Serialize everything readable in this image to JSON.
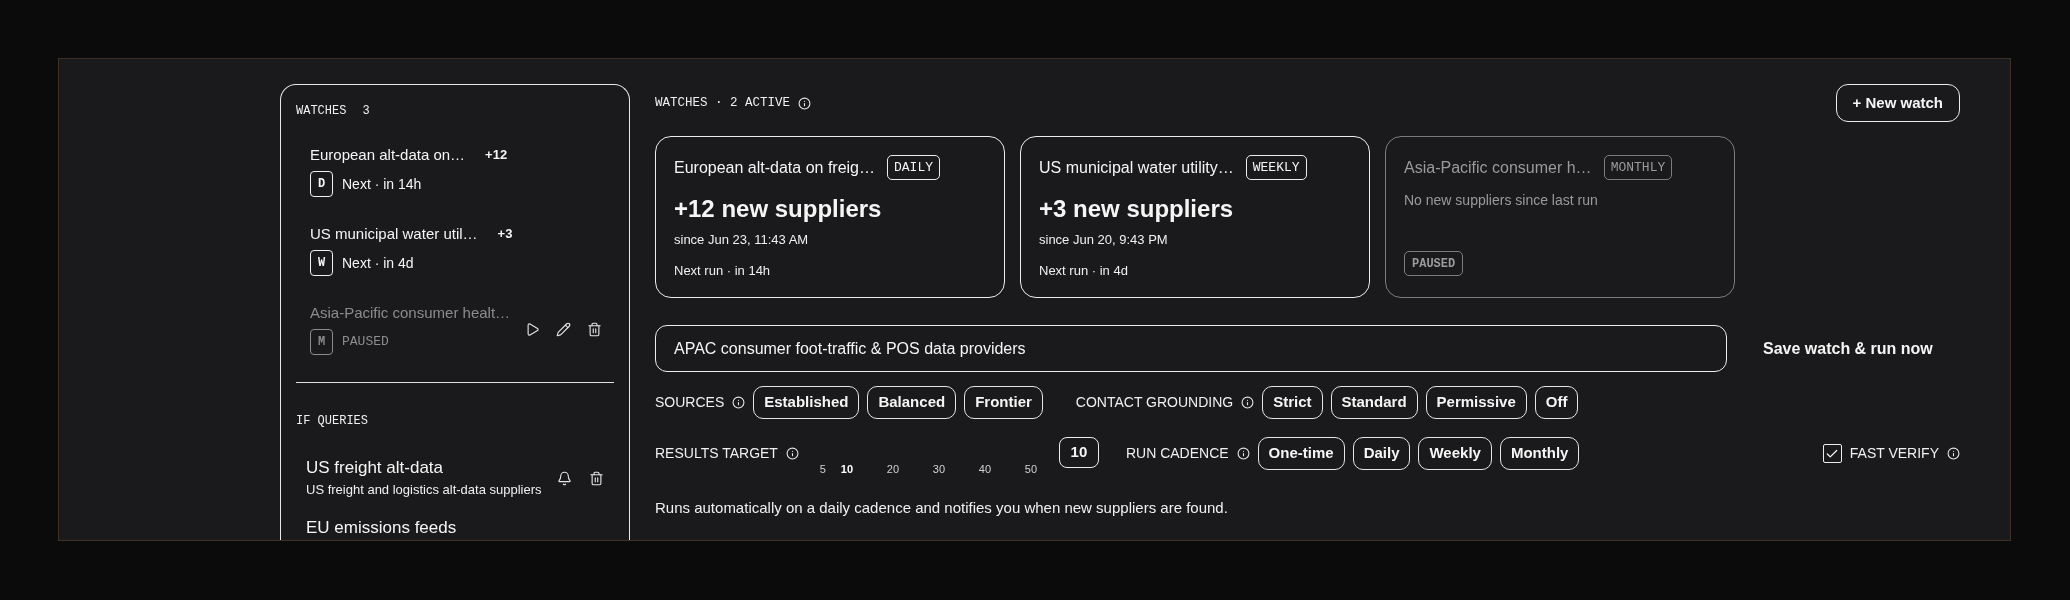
{
  "sidebar": {
    "watches_heading": {
      "label": "WATCHES",
      "count": "3"
    },
    "watches": [
      {
        "title": "European alt-data on…",
        "delta": "+12",
        "cadence": "D",
        "status": "Next · in 14h",
        "paused": false
      },
      {
        "title": "US municipal water util…",
        "delta": "+3",
        "cadence": "W",
        "status": "Next · in 4d",
        "paused": false
      },
      {
        "title": "Asia-Pacific consumer healt…",
        "cadence": "M",
        "status": "PAUSED",
        "paused": true
      }
    ],
    "queries_heading": "IF QUERIES",
    "queries": [
      {
        "title": "US freight alt-data",
        "subtitle": "US freight and logistics alt-data suppliers"
      },
      {
        "title": "EU emissions feeds"
      }
    ]
  },
  "header": {
    "title": "WATCHES · 2 ACTIVE",
    "new_watch_button": "+ New watch"
  },
  "cards": [
    {
      "title": "European alt-data on freig…",
      "cadence": "DAILY",
      "headline": "+12 new suppliers",
      "since": "since Jun 23, 11:43 AM",
      "next_run": "Next run · in 14h",
      "paused": false
    },
    {
      "title": "US municipal water utility…",
      "cadence": "WEEKLY",
      "headline": "+3 new suppliers",
      "since": "since Jun 20, 9:43 PM",
      "next_run": "Next run · in 4d",
      "paused": false
    },
    {
      "title": "Asia-Pacific consumer h…",
      "cadence": "MONTHLY",
      "message": "No new suppliers since last run",
      "status": "PAUSED",
      "paused": true
    }
  ],
  "composer": {
    "query_input": {
      "value": "APAC consumer foot-traffic & POS data providers"
    },
    "save_button": "Save watch & run now",
    "sources": {
      "label": "SOURCES",
      "options": [
        "Established",
        "Balanced",
        "Frontier"
      ]
    },
    "contact_grounding": {
      "label": "CONTACT GROUNDING",
      "options": [
        "Strict",
        "Standard",
        "Permissive",
        "Off"
      ]
    },
    "results_target": {
      "label": "RESULTS TARGET",
      "ticks": [
        {
          "label": "5",
          "selected": false
        },
        {
          "label": "10",
          "selected": true
        },
        {
          "label": "20",
          "selected": false
        },
        {
          "label": "30",
          "selected": false
        },
        {
          "label": "40",
          "selected": false
        },
        {
          "label": "50",
          "selected": false
        }
      ],
      "value": "10"
    },
    "run_cadence": {
      "label": "RUN CADENCE",
      "options": [
        "One-time",
        "Daily",
        "Weekly",
        "Monthly"
      ]
    },
    "fast_verify": {
      "label": "FAST VERIFY",
      "checked": true
    },
    "description": "Runs automatically on a daily cadence and notifies you when new suppliers are found."
  }
}
